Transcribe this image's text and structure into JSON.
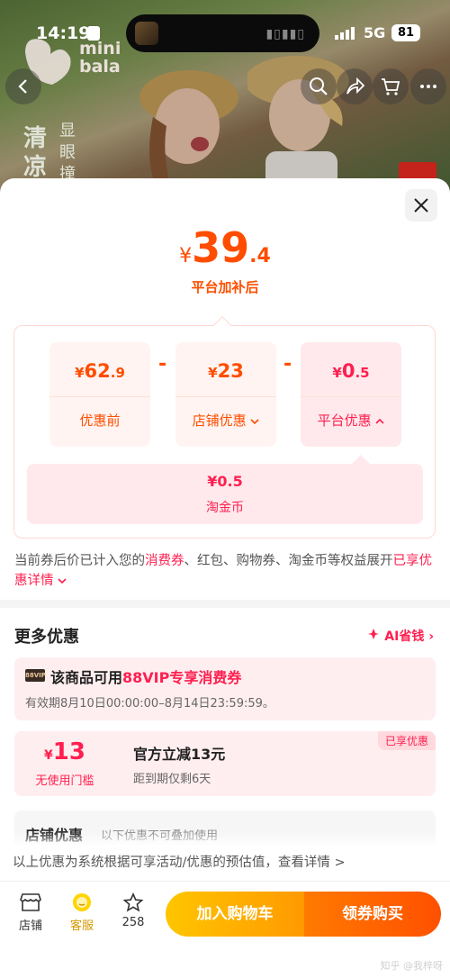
{
  "status_bar": {
    "time": "14:19",
    "network": "5G",
    "battery": "81"
  },
  "brand": {
    "logo_line1": "mini",
    "logo_line2": "bala"
  },
  "banner": {
    "tag_big1": "清",
    "tag_big2": "凉",
    "tag_small1": "显",
    "tag_small2": "眼",
    "tag_small3": "撞"
  },
  "price": {
    "currency": "¥",
    "integer": "39",
    "decimal": ".4",
    "caption": "平台加补后"
  },
  "breakdown": {
    "original": {
      "currency": "¥",
      "integer": "62",
      "decimal": ".9",
      "label": "优惠前"
    },
    "shop": {
      "currency": "¥",
      "integer": "23",
      "label": "店铺优惠"
    },
    "platform": {
      "currency": "¥",
      "integer": "0",
      "decimal": ".5",
      "label": "平台优惠"
    },
    "minus": "-",
    "coin": {
      "value": "¥0.5",
      "label": "淘金币"
    }
  },
  "note": {
    "part1": "当前券后价已计入您的",
    "hl1": "消费券",
    "part2": "、红包、购物券、淘金币等权益展开",
    "hl2": "已享优惠详情"
  },
  "more": {
    "title": "更多优惠",
    "ai_label": "AI省钱",
    "vip": {
      "badge": "88VIP",
      "title_prefix": "该商品可用",
      "title_highlight": "88VIP专享消费券",
      "validity": "有效期8月10日00:00:00–8月14日23:59:59。"
    },
    "coupon": {
      "currency": "¥",
      "amount": "13",
      "threshold": "无使用门槛",
      "title": "官方立减13元",
      "expiry": "距到期仅剩6天",
      "badge": "已享优惠"
    },
    "shop": {
      "title": "店铺优惠",
      "subtitle": "以下优惠不可叠加使用"
    }
  },
  "estimate_note": "以上优惠为系统根据可享活动/优惠的预估值，查看详情 >",
  "bottom_bar": {
    "shop_label": "店铺",
    "service_label": "客服",
    "fav_count": "258",
    "cart_button": "加入购物车",
    "buy_button": "领券购买"
  },
  "watermark": "知乎 @我梓呀",
  "colors": {
    "accent_orange": "#ff5000",
    "accent_red": "#ff1f4f",
    "cart_yellow": "#ffb300"
  }
}
